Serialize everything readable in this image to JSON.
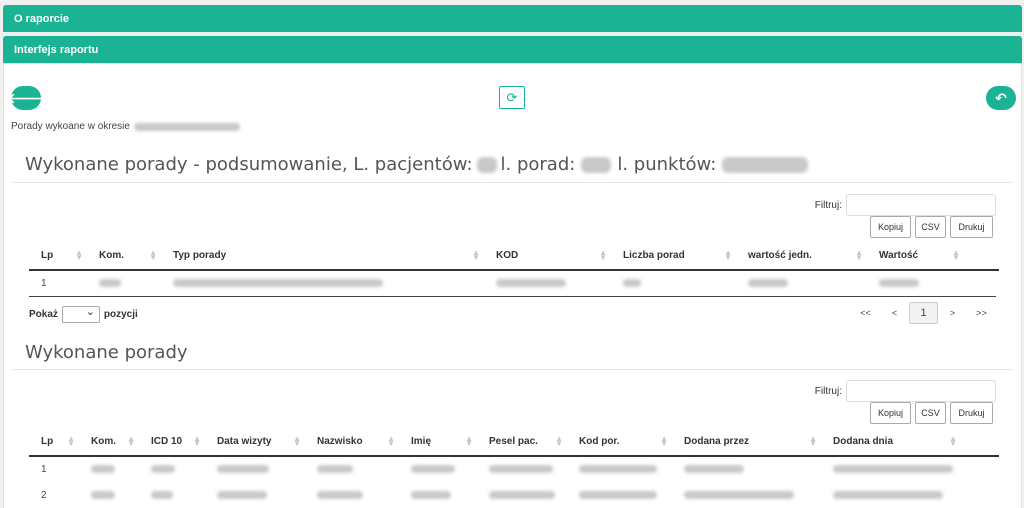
{
  "bars": {
    "about": "O raporcie",
    "interface": "Interfejs raportu"
  },
  "toolbar": {
    "back_icon": "🡐",
    "refresh_icon": "⟳",
    "undo_icon": "↶"
  },
  "period_label": "Porady wykoane w okresie",
  "summary": {
    "title_a": "Wykonane porady - podsumowanie, L. pacjentów:",
    "title_b": "l. porad:",
    "title_c": "l. punktów:",
    "filter_label": "Filtruj:",
    "buttons": [
      "Kopiuj",
      "CSV",
      "Drukuj"
    ],
    "columns": [
      "Lp",
      "Kom.",
      "Typ porady",
      "KOD",
      "Liczba porad",
      "wartość jedn.",
      "Wartość"
    ],
    "rows": [
      [
        "1"
      ]
    ]
  },
  "pager": {
    "show_label": "Pokaż",
    "items_label": "pozycji",
    "first": "<<",
    "prev": "<",
    "current": "1",
    "next": ">",
    "last": ">>"
  },
  "details": {
    "title": "Wykonane porady",
    "filter_label": "Filtruj:",
    "buttons": [
      "Kopiuj",
      "CSV",
      "Drukuj"
    ],
    "columns": [
      "Lp",
      "Kom.",
      "ICD 10",
      "Data wizyty",
      "Nazwisko",
      "Imię",
      "Pesel pac.",
      "Kod por.",
      "Dodana przez",
      "Dodana dnia"
    ],
    "rows": [
      [
        "1"
      ],
      [
        "2"
      ]
    ]
  },
  "colors": {
    "accent": "#1ab394"
  }
}
